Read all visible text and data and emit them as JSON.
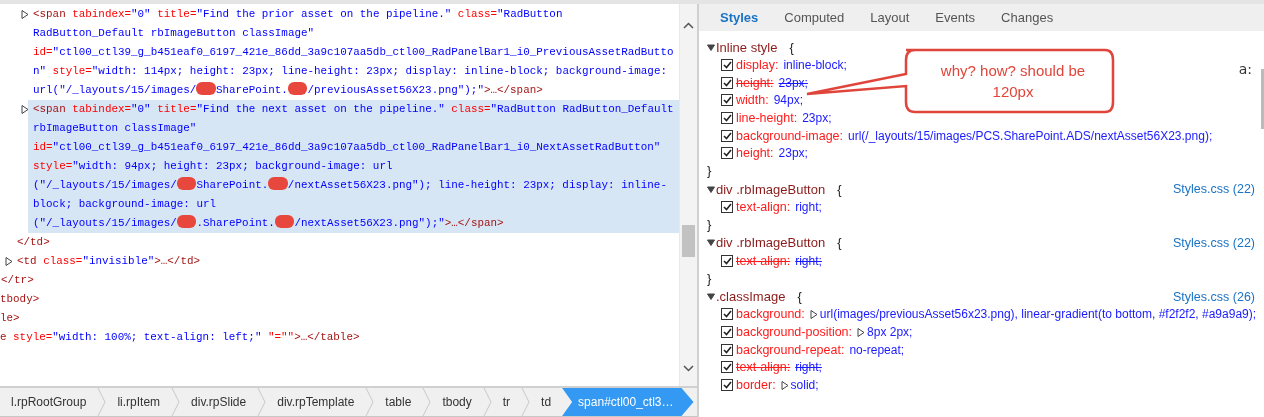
{
  "dom_tree": [
    {
      "children": [
        {
          "children": [
            {
              "children": [
                {
                  "children": [
                    {
                      "expanded": false,
                      "selected": false,
                      "lines": [
                        [
                          {
                            "kind": "tag",
                            "text": "<span "
                          },
                          {
                            "kind": "attr",
                            "text": "tabindex="
                          },
                          {
                            "kind": "value",
                            "text": "\"0\" "
                          },
                          {
                            "kind": "attr",
                            "text": "title="
                          },
                          {
                            "kind": "value",
                            "text": "\"Find the prior asset on the pipeline.\" "
                          },
                          {
                            "kind": "attr",
                            "text": "class="
                          },
                          {
                            "kind": "value",
                            "text": "\"RadButton"
                          }
                        ],
                        [
                          {
                            "kind": "value",
                            "text": "RadButton_Default rbImageButton classImage\""
                          }
                        ],
                        [
                          {
                            "kind": "attr",
                            "text": "id="
                          },
                          {
                            "kind": "value",
                            "text": "\"ctl00_ctl39_g_b451eaf0_6197_421e_86dd_3a9c107aa5db_ctl00_RadPanelBar1_i0_PreviousAssetRadButto"
                          }
                        ],
                        [
                          {
                            "kind": "value",
                            "text": "n\" "
                          },
                          {
                            "kind": "attr",
                            "text": "style="
                          },
                          {
                            "kind": "value",
                            "text": "\"width: 114px; height: 23px; line-height: 23px; display: inline-block; background-image:"
                          }
                        ],
                        [
                          {
                            "kind": "value",
                            "text": "url(\"/_layouts/15/images/"
                          },
                          {
                            "kind": "redaction"
                          },
                          {
                            "kind": "value",
                            "text": "SharePoint."
                          },
                          {
                            "kind": "redaction"
                          },
                          {
                            "kind": "value",
                            "text": "/previousAsset56X23.png\");\""
                          },
                          {
                            "kind": "tag",
                            "text": ">…</span>"
                          }
                        ]
                      ]
                    },
                    {
                      "expanded": false,
                      "selected": true,
                      "lines": [
                        [
                          {
                            "kind": "tag",
                            "text": "<span "
                          },
                          {
                            "kind": "attr",
                            "text": "tabindex="
                          },
                          {
                            "kind": "value",
                            "text": "\"0\" "
                          },
                          {
                            "kind": "attr",
                            "text": "title="
                          },
                          {
                            "kind": "value",
                            "text": "\"Find the next asset on the pipeline.\" "
                          },
                          {
                            "kind": "attr",
                            "text": "class="
                          },
                          {
                            "kind": "value",
                            "text": "\"RadButton RadButton_Default"
                          }
                        ],
                        [
                          {
                            "kind": "value",
                            "text": "rbImageButton classImage\""
                          }
                        ],
                        [
                          {
                            "kind": "attr",
                            "text": "id="
                          },
                          {
                            "kind": "value",
                            "text": "\"ctl00_ctl39_g_b451eaf0_6197_421e_86dd_3a9c107aa5db_ctl00_RadPanelBar1_i0_NextAssetRadButton\""
                          }
                        ],
                        [
                          {
                            "kind": "attr",
                            "text": "style="
                          },
                          {
                            "kind": "value",
                            "text": "\"width: 94px; height: 23px; background-image: url"
                          }
                        ],
                        [
                          {
                            "kind": "value",
                            "text": "(\"/_layouts/15/images/"
                          },
                          {
                            "kind": "redaction"
                          },
                          {
                            "kind": "value",
                            "text": "SharePoint."
                          },
                          {
                            "kind": "redaction"
                          },
                          {
                            "kind": "value",
                            "text": "/nextAsset56X23.png\"); line-height: 23px; display: inline-"
                          }
                        ],
                        [
                          {
                            "kind": "value",
                            "text": "block; background-image: url"
                          }
                        ],
                        [
                          {
                            "kind": "value",
                            "text": "(\"/_layouts/15/images/"
                          },
                          {
                            "kind": "redaction"
                          },
                          {
                            "kind": "value",
                            "text": ".SharePoint."
                          },
                          {
                            "kind": "redaction"
                          },
                          {
                            "kind": "value",
                            "text": "/nextAsset56X23.png\");\""
                          },
                          {
                            "kind": "tag",
                            "text": ">…</span>"
                          }
                        ]
                      ]
                    }
                  ],
                  "close": [
                    {
                      "kind": "tag",
                      "text": "</td>"
                    }
                  ]
                },
                {
                  "expanded": false,
                  "selected": false,
                  "lines": [
                    [
                      {
                        "kind": "tag",
                        "text": "<td "
                      },
                      {
                        "kind": "attr",
                        "text": "class="
                      },
                      {
                        "kind": "value",
                        "text": "\"invisible\""
                      },
                      {
                        "kind": "tag",
                        "text": ">…</td>"
                      }
                    ]
                  ]
                }
              ],
              "close": [
                {
                  "kind": "tag",
                  "text": "</tr>"
                }
              ]
            }
          ],
          "close": [
            {
              "kind": "tag",
              "text": "tbody>"
            }
          ]
        }
      ],
      "close": [
        {
          "kind": "tag",
          "text": "le>"
        }
      ]
    },
    {
      "selected": false,
      "lines": [
        [
          {
            "kind": "tag",
            "text": "e "
          },
          {
            "kind": "attr",
            "text": "style="
          },
          {
            "kind": "value",
            "text": "\"width: 100%; text-align: left;\" "
          },
          {
            "kind": "attr",
            "text": "\"=\"\""
          },
          {
            "kind": "tag",
            "text": ">…</table>"
          }
        ]
      ]
    }
  ],
  "breadcrumb": [
    {
      "label": "l.rpRootGroup",
      "selected": false
    },
    {
      "label": "li.rpItem",
      "selected": false
    },
    {
      "label": "div.rpSlide",
      "selected": false
    },
    {
      "label": "div.rpTemplate",
      "selected": false
    },
    {
      "label": "table",
      "selected": false
    },
    {
      "label": "tbody",
      "selected": false
    },
    {
      "label": "tr",
      "selected": false
    },
    {
      "label": "td",
      "selected": false
    },
    {
      "label": "span#ctl00_ctl3…",
      "selected": true
    }
  ],
  "tabs": [
    {
      "label": "Styles",
      "selected": true
    },
    {
      "label": "Computed",
      "selected": false
    },
    {
      "label": "Layout",
      "selected": false
    },
    {
      "label": "Events",
      "selected": false
    },
    {
      "label": "Changes",
      "selected": false
    }
  ],
  "pseudo_state_button": "a:",
  "rules": [
    {
      "selector": "Inline style",
      "open": "{",
      "close": "}",
      "expanded": true,
      "declarations": [
        {
          "checked": true,
          "name": "display:",
          "value": "inline-block;",
          "overridden": false
        },
        {
          "checked": true,
          "name": "height:",
          "value": "23px;",
          "overridden": true
        },
        {
          "checked": true,
          "name": "width:",
          "value": "94px;",
          "overridden": false
        },
        {
          "checked": true,
          "name": "line-height:",
          "value": "23px;",
          "overridden": false
        },
        {
          "checked": true,
          "name": "background-image:",
          "value": "url(/_layouts/15/images/PCS.SharePoint.ADS/nextAsset56X23.png);",
          "overridden": false
        },
        {
          "checked": true,
          "name": "height:",
          "value": "23px;",
          "overridden": false
        }
      ]
    },
    {
      "selector": "div .rbImageButton",
      "open": "{",
      "close": "}",
      "source": "Styles.css (22)",
      "expanded": true,
      "declarations": [
        {
          "checked": true,
          "name": "text-align:",
          "value": "right;",
          "overridden": false
        }
      ]
    },
    {
      "selector": "div .rbImageButton",
      "open": "{",
      "close": "}",
      "source": "Styles.css (22)",
      "expanded": true,
      "declarations": [
        {
          "checked": true,
          "name": "text-align:",
          "value": "right;",
          "overridden": true
        }
      ]
    },
    {
      "selector": ".classImage",
      "open": "{",
      "source": "Styles.css (26)",
      "expanded": true,
      "declarations": [
        {
          "checked": true,
          "name": "background:",
          "value": "url(images/previousAsset56x23.png), linear-gradient(to bottom, #f2f2f2, #a9a9a9);",
          "overridden": false,
          "expandable": true
        },
        {
          "checked": true,
          "name": "background-position:",
          "value": "8px 2px;",
          "overridden": false,
          "expandable": true
        },
        {
          "checked": true,
          "name": "background-repeat:",
          "value": "no-repeat;",
          "overridden": false
        },
        {
          "checked": true,
          "name": "text-align:",
          "value": "right;",
          "overridden": true
        },
        {
          "checked": true,
          "name": "border:",
          "value": "solid;",
          "overridden": false,
          "expandable": true
        }
      ]
    }
  ],
  "callout": {
    "text": "why? how? should be 120px"
  }
}
